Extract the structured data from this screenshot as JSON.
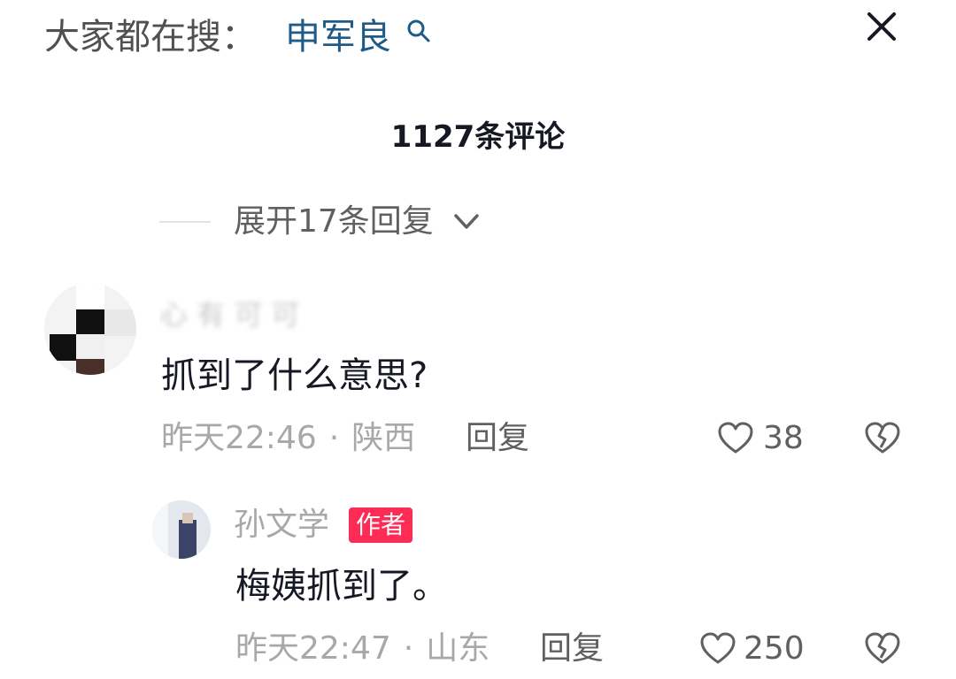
{
  "search_bar": {
    "prefix": "大家都在搜：",
    "term": "申军良",
    "icon": "search-icon",
    "close_icon": "close-icon"
  },
  "comments_header": {
    "count_label": "1127条评论"
  },
  "expand": {
    "label": "展开17条回复",
    "icon": "chevron-down-icon"
  },
  "comments": [
    {
      "username": "心 有 可 可",
      "text": "抓到了什么意思?",
      "time": "昨天22:46",
      "separator": "·",
      "location": "陕西",
      "reply_label": "回复",
      "likes": "38"
    },
    {
      "username": "孙文学",
      "badge": "作者",
      "text": "梅姨抓到了。",
      "time": "昨天22:47",
      "separator": "·",
      "location": "山东",
      "reply_label": "回复",
      "likes": "250"
    }
  ],
  "colors": {
    "accent_badge": "#fe2c55",
    "search_term": "#1f5b86",
    "meta_text": "#a8a8a8"
  }
}
